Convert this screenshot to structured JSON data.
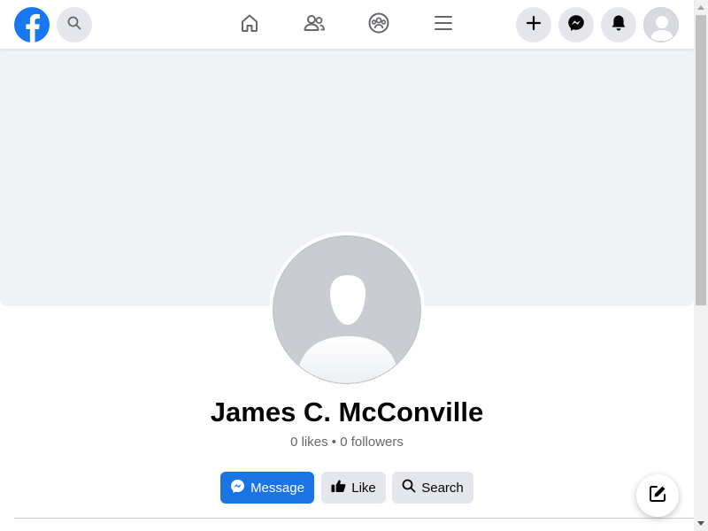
{
  "nav": {
    "logo_icon": "facebook-logo-icon",
    "search_icon": "search-icon",
    "center_icons": [
      "home-icon",
      "friends-icon",
      "groups-icon",
      "menu-icon"
    ],
    "right_icons": [
      "plus-icon",
      "messenger-icon",
      "bell-icon",
      "account-avatar"
    ]
  },
  "profile": {
    "name": "James C. McConville",
    "stats": "0 likes • 0 followers"
  },
  "actions": {
    "message_label": "Message",
    "like_label": "Like",
    "search_label": "Search"
  },
  "colors": {
    "brand": "#1877f2",
    "primary_button": "#1b74e4",
    "secondary_button": "#e4e6eb",
    "cover": "#f0f2f5"
  }
}
